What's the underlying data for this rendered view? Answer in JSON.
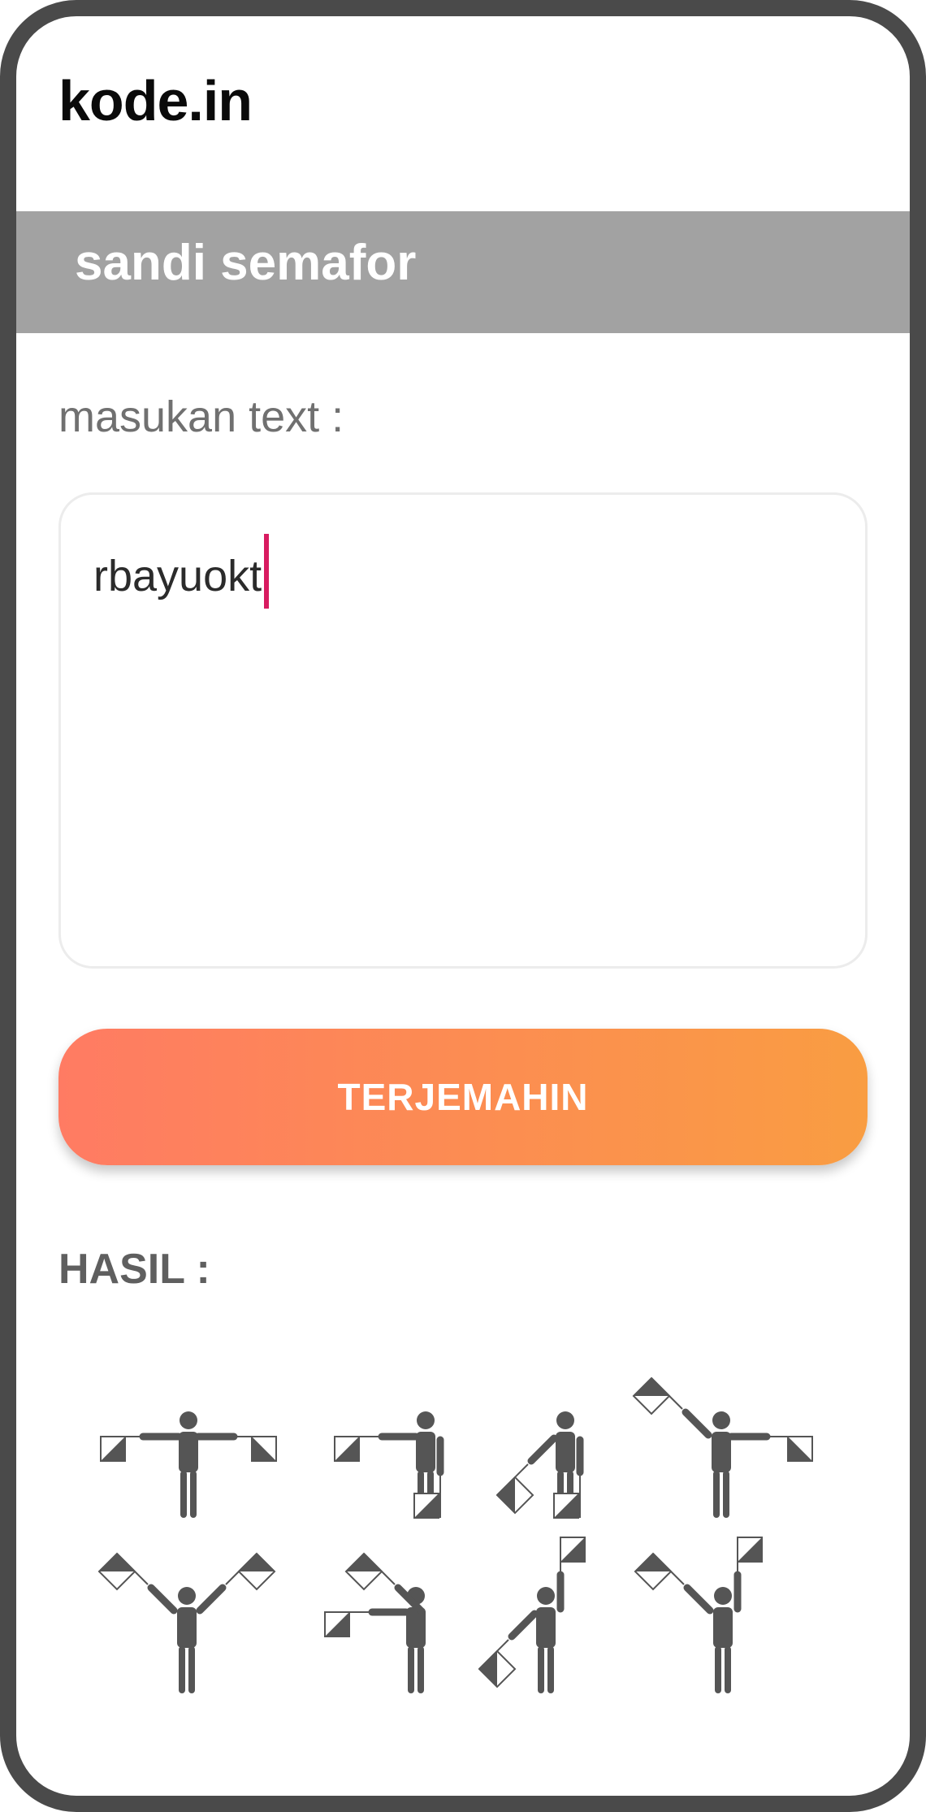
{
  "app": {
    "brand": "kode.in"
  },
  "banner": {
    "title": "sandi semafor"
  },
  "form": {
    "label": "masukan text :",
    "input_value": "rbayuokt",
    "button_label": "TERJEMAHIN"
  },
  "result": {
    "label": "HASIL :",
    "letters": [
      "r",
      "b",
      "a",
      "y",
      "u",
      "o",
      "k",
      "t"
    ]
  },
  "colors": {
    "banner": "#a2a2a2",
    "button_gradient_start": "#ff7b63",
    "button_gradient_end": "#f99d42",
    "caret": "#d81b60",
    "figure": "#555555",
    "frame": "#4a4a4a"
  }
}
